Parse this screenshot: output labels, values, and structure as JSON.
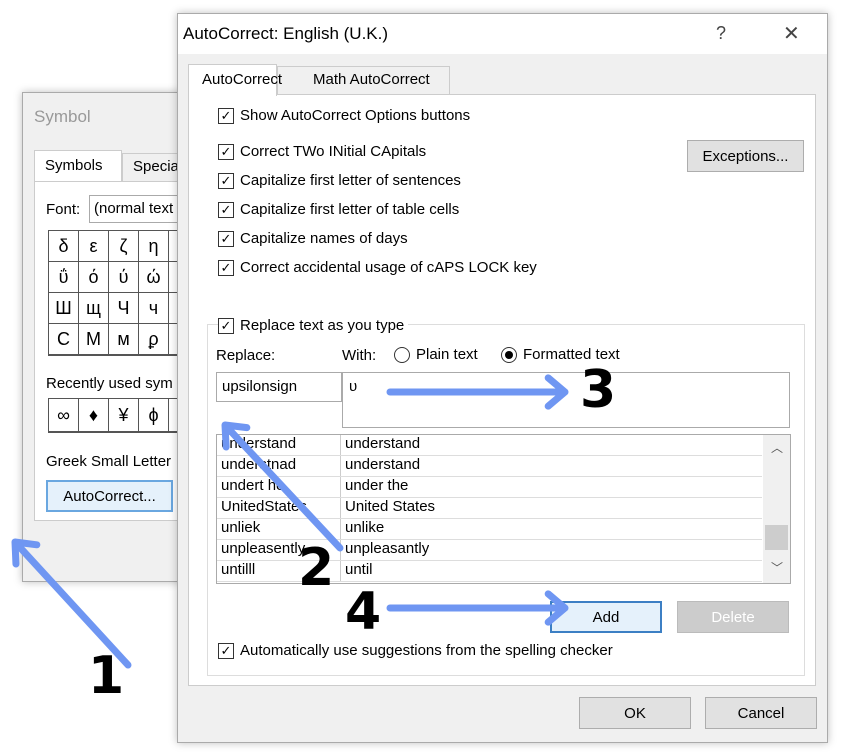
{
  "symbol_dialog": {
    "title": "Symbol",
    "tabs": [
      "Symbols",
      "Special"
    ],
    "font_label": "Font:",
    "font_value": "(normal text",
    "symbols": [
      [
        "δ",
        "ε",
        "ζ",
        "η"
      ],
      [
        "ΰ",
        "ό",
        "ύ",
        "ώ"
      ],
      [
        "Ш",
        "щ",
        "Ч",
        "ч"
      ],
      [
        "С",
        "М",
        "м",
        "ϼ"
      ]
    ],
    "recent_label": "Recently used sym",
    "recent": [
      "∞",
      "♦",
      "¥",
      "ϕ"
    ],
    "char_name": "Greek Small Letter",
    "autocorrect_button": "AutoCorrect..."
  },
  "autocorrect_dialog": {
    "title": "AutoCorrect: English (U.K.)",
    "help": "?",
    "close": "✕",
    "tabs": [
      "AutoCorrect",
      "Math AutoCorrect"
    ],
    "options": [
      "Show AutoCorrect Options buttons",
      "Correct TWo INitial CApitals",
      "Capitalize first letter of sentences",
      "Capitalize first letter of table cells",
      "Capitalize names of days",
      "Correct accidental usage of cAPS LOCK key"
    ],
    "exceptions_button": "Exceptions...",
    "replace_as_you_type": "Replace text as you type",
    "replace_label": "Replace:",
    "with_label": "With:",
    "plain_text": "Plain text",
    "formatted_text": "Formatted text",
    "replace_value": "upsilonsign",
    "with_value": "υ",
    "entries": [
      [
        "understand",
        "understand"
      ],
      [
        "understnad",
        "understand"
      ],
      [
        "undert he",
        "under the"
      ],
      [
        "UnitedStates",
        "United States"
      ],
      [
        "unliek",
        "unlike"
      ],
      [
        "unpleasently",
        "unpleasantly"
      ],
      [
        "untilll",
        "until"
      ]
    ],
    "add_button": "Add",
    "delete_button": "Delete",
    "spelling_suggestions": "Automatically use suggestions from the spelling checker",
    "ok_button": "OK",
    "cancel_button": "Cancel"
  },
  "annotations": {
    "steps": [
      "1",
      "2",
      "3",
      "4"
    ],
    "arrow_color": "#6f96f2"
  }
}
